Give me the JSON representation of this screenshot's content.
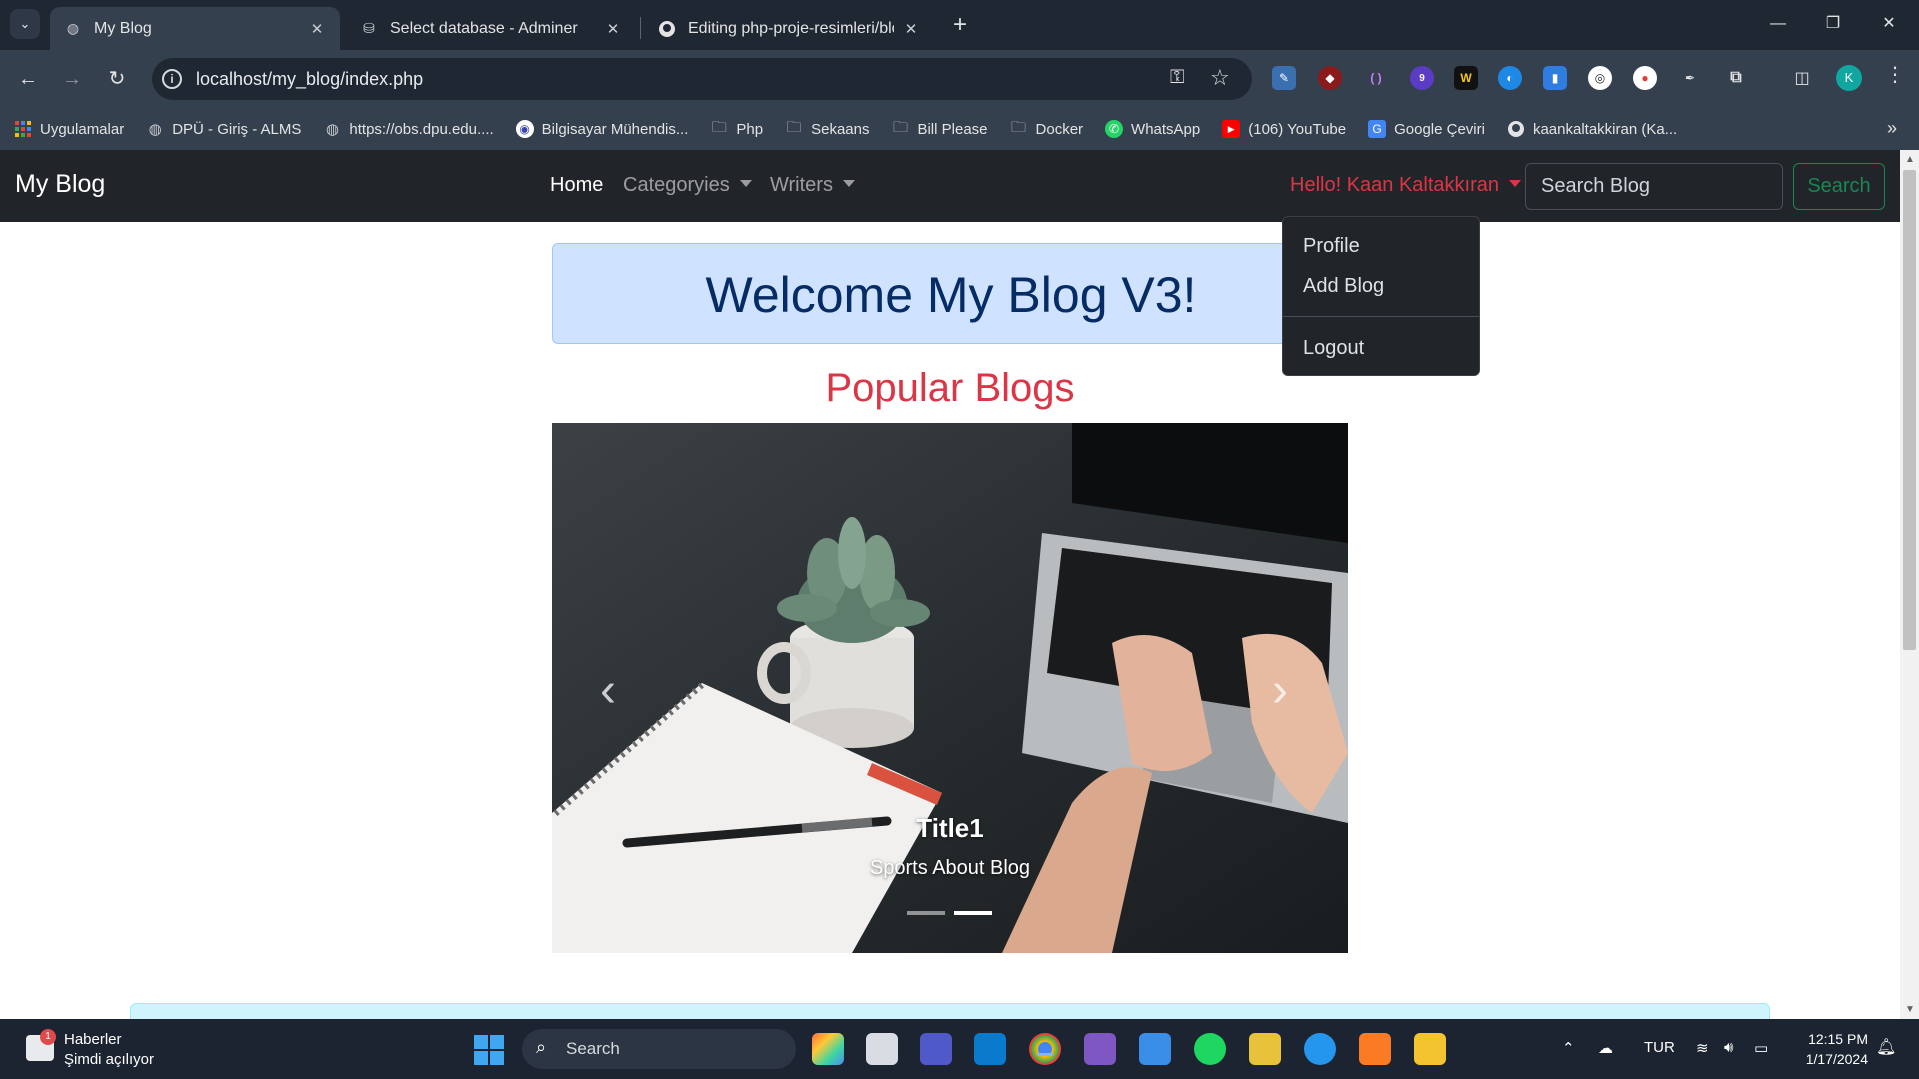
{
  "browser": {
    "tabs": [
      {
        "title": "My Blog",
        "active": true
      },
      {
        "title": "Select database - Adminer",
        "active": false
      },
      {
        "title": "Editing php-proje-resimleri/blo",
        "active": false
      }
    ],
    "url": "localhost/my_blog/index.php",
    "profile_initial": "K",
    "extension_badge": "9",
    "bookmarks": [
      {
        "label": "Uygulamalar",
        "icon": "apps-grid-icon"
      },
      {
        "label": "DPÜ - Giriş - ALMS",
        "icon": "globe-icon"
      },
      {
        "label": "https://obs.dpu.edu....",
        "icon": "globe-icon"
      },
      {
        "label": "Bilgisayar Mühendis...",
        "icon": "site-icon"
      },
      {
        "label": "Php",
        "icon": "folder-icon"
      },
      {
        "label": "Sekaans",
        "icon": "folder-icon"
      },
      {
        "label": "Bill Please",
        "icon": "folder-icon"
      },
      {
        "label": "Docker",
        "icon": "folder-icon"
      },
      {
        "label": "WhatsApp",
        "icon": "whatsapp-icon"
      },
      {
        "label": "(106) YouTube",
        "icon": "youtube-icon"
      },
      {
        "label": "Google Çeviri",
        "icon": "google-translate-icon"
      },
      {
        "label": "kaankaltakkiran (Ka...",
        "icon": "github-icon"
      }
    ]
  },
  "site": {
    "brand": "My Blog",
    "nav": {
      "home": "Home",
      "categories": "Categoryies",
      "writers": "Writers"
    },
    "user_greeting": "Hello! Kaan Kaltakkıran",
    "search_placeholder": "Search Blog",
    "search_button": "Search",
    "dropdown": {
      "profile": "Profile",
      "add_blog": "Add Blog",
      "logout": "Logout"
    },
    "welcome": "Welcome My Blog V3!",
    "popular_heading": "Popular Blogs",
    "carousel": {
      "title": "Title1",
      "text": "Sports About Blog",
      "slide_count": 2,
      "active_index": 1
    }
  },
  "taskbar": {
    "news_title": "Haberler",
    "news_subtitle": "Şimdi açılıyor",
    "news_badge": "1",
    "search_label": "Search",
    "language": "TUR",
    "time": "12:15 PM",
    "date": "1/17/2024"
  }
}
